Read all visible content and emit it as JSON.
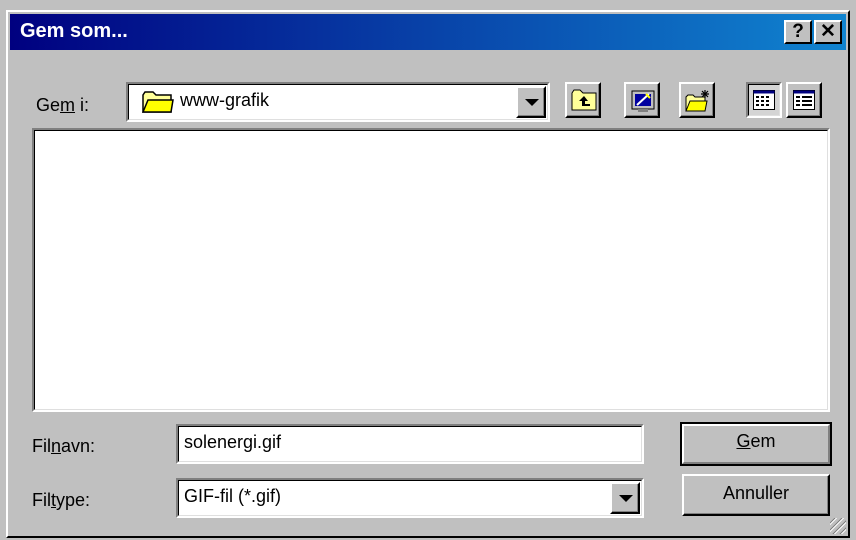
{
  "dialog": {
    "title": "Gem som...",
    "help_button": "?",
    "close_button": "✕"
  },
  "location": {
    "label_pre": "Ge",
    "label_accel": "m",
    "label_post": " i:",
    "folder": "www-grafik",
    "folder_icon": "folder-icon",
    "toolbar": [
      "up-one-level-icon",
      "desktop-icon",
      "new-folder-icon",
      "list-view-icon",
      "details-view-icon"
    ]
  },
  "file_list": {
    "items": []
  },
  "filename": {
    "label_pre": "Fil",
    "label_accel": "n",
    "label_post": "avn:",
    "value": "solenergi.gif"
  },
  "filetype": {
    "label_pre": "Fil",
    "label_accel": "t",
    "label_post": "ype:",
    "value": "GIF-fil (*.gif)"
  },
  "buttons": {
    "save_accel": "G",
    "save_rest": "em",
    "cancel": "Annuller"
  },
  "colors": {
    "face": "#c0c0c0",
    "title_start": "#000080",
    "title_end": "#1084d0"
  }
}
